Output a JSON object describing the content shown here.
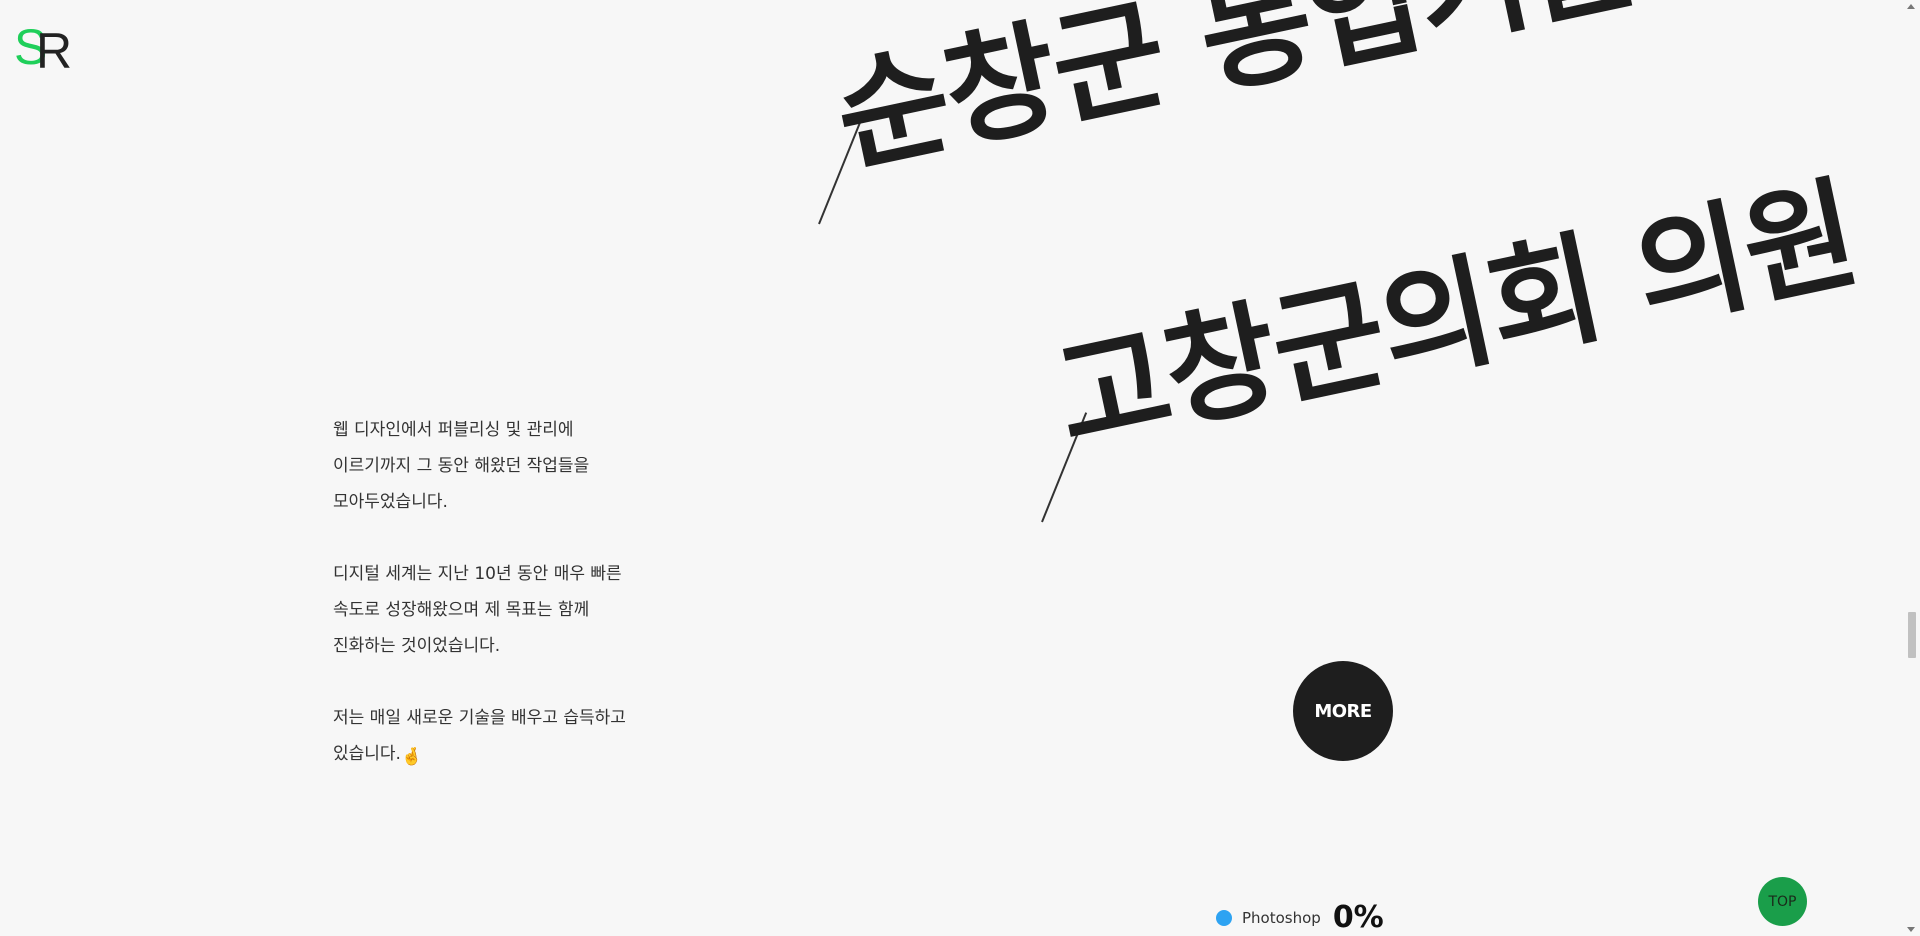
{
  "logo": {
    "first_letter": "S",
    "second_letter": "R",
    "first_color": "#1fcf5a",
    "second_color": "#222222"
  },
  "intro": {
    "paragraphs": [
      "웹 디자인에서 퍼블리싱 및 관리에\n이르기까지 그 동안 해왔던 작업들을\n모아두었습니다.",
      "디지털 세계는 지난 10년 동안 매우 빠른\n속도로 성장해왔으며 제 목표는 함께\n진화하는 것이었습니다.",
      "저는 매일 새로운 기술을 배우고 습득하고\n있습니다."
    ],
    "emoji": "🤞"
  },
  "titles": [
    "순창군 농업기술센터",
    "고창군의회 의원"
  ],
  "more_button": {
    "label": "MORE"
  },
  "skills": [
    {
      "name": "Photoshop",
      "value": "0%",
      "color": "#2ea3f2"
    }
  ],
  "top_button": {
    "label": "TOP",
    "color": "#1a9e4a"
  }
}
